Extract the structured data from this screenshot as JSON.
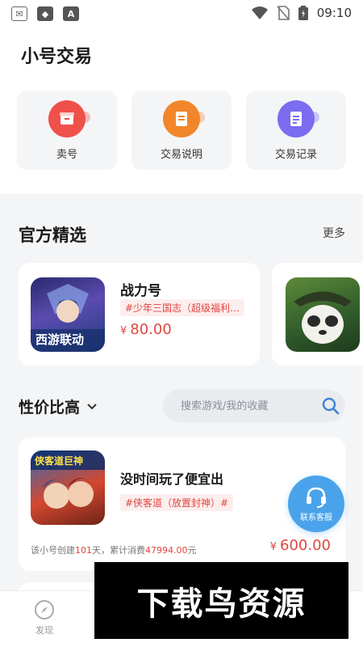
{
  "status": {
    "time": "09:10",
    "icons": [
      "notification-icon",
      "alert-icon",
      "a-icon"
    ]
  },
  "page": {
    "title": "小号交易"
  },
  "quick_actions": [
    {
      "label": "卖号",
      "icon": "sell-icon",
      "color": "#f0504a"
    },
    {
      "label": "交易说明",
      "icon": "doc-icon",
      "color": "#f2862a"
    },
    {
      "label": "交易记录",
      "icon": "record-icon",
      "color": "#7b6cf0"
    }
  ],
  "featured": {
    "title": "官方精选",
    "more": "更多",
    "items": [
      {
        "name": "战力号",
        "tag": "#少年三国志（超级福利…",
        "currency": "¥",
        "price": "80.00",
        "image_text": "西游联动"
      }
    ]
  },
  "sort": {
    "label": "性价比高"
  },
  "search": {
    "placeholder": "搜索游戏/我的收藏"
  },
  "listing": {
    "title": "没时间玩了便宜出",
    "tag": "#侠客道（放置封神）#",
    "currency": "¥",
    "price": "600.00",
    "meta_prefix": "该小号创建",
    "days": "101",
    "meta_mid": "天，累计消费",
    "spent": "47994.00",
    "meta_suffix": "元",
    "image_text": "侠客道巨神"
  },
  "service": {
    "label": "联系客服"
  },
  "tabbar": {
    "discover": "发现"
  },
  "watermark": "下载鸟资源"
}
